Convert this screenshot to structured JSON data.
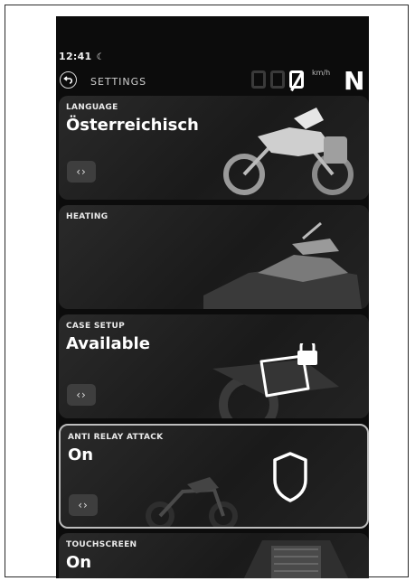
{
  "status": {
    "time": "12:41",
    "moon_icon": "moon-icon"
  },
  "header": {
    "back_label": "SETTINGS"
  },
  "speed": {
    "digits": [
      "",
      "",
      "0"
    ],
    "unit": "km/h",
    "gear": "N"
  },
  "cards": [
    {
      "title": "LANGUAGE",
      "value": "Österreichisch",
      "arrows": "‹›"
    },
    {
      "title": "HEATING",
      "value": "",
      "arrows": ""
    },
    {
      "title": "CASE SETUP",
      "value": "Available",
      "arrows": "‹›"
    },
    {
      "title": "ANTI RELAY ATTACK",
      "value": "On",
      "arrows": "‹›"
    },
    {
      "title": "TOUCHSCREEN",
      "value": "On",
      "arrows": ""
    }
  ],
  "colors": {
    "screen_bg": "#0c0c0c",
    "card_bg": "#232323",
    "text": "#ffffff"
  }
}
